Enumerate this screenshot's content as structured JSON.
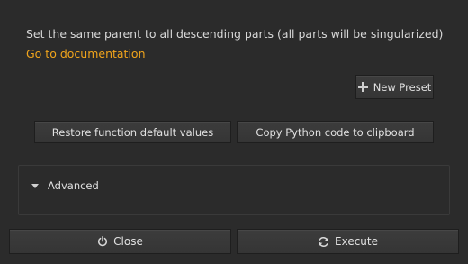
{
  "description": "Set the same parent to all descending parts (all parts will be singularized)",
  "documentation_link": "Go to documentation",
  "preset": {
    "new_label": "New Preset",
    "icon": "plus-icon"
  },
  "actions": {
    "restore_label": "Restore function default values",
    "copy_label": "Copy Python code to clipboard"
  },
  "advanced": {
    "label": "Advanced",
    "icon": "triangle-down-icon"
  },
  "footer": {
    "close_label": "Close",
    "close_icon": "power-icon",
    "execute_label": "Execute",
    "execute_icon": "refresh-icon"
  },
  "colors": {
    "background": "#2b2b2b",
    "link": "#f0a41c",
    "button": "#3a3a3a"
  }
}
